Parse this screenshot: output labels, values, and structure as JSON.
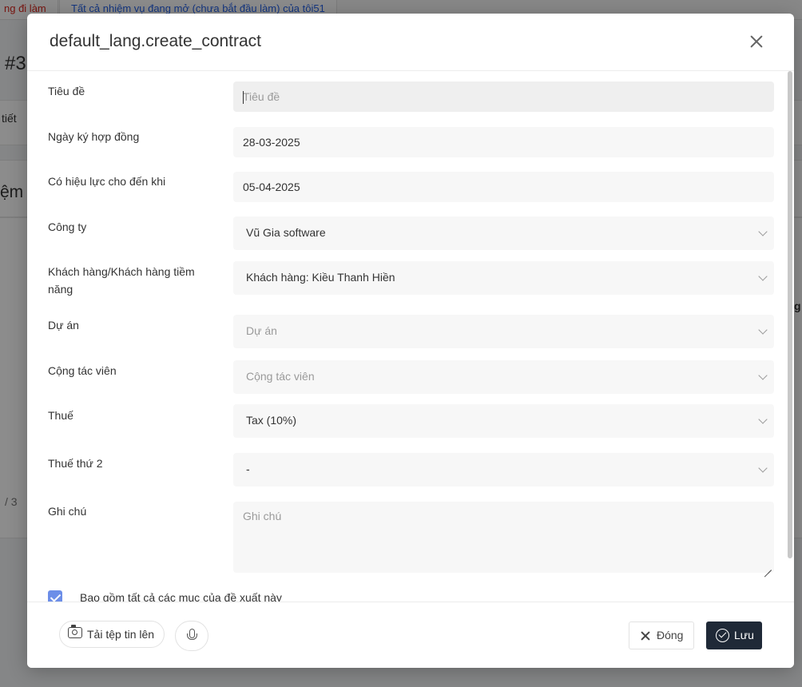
{
  "background": {
    "tabs": [
      "ng đi làm",
      "Tất cả nhiệm vụ đang mở (chưa bắt đầu làm) của tôi51"
    ],
    "fragments": {
      "hash_number": "#3",
      "tiet": "tiết",
      "nhiem": "ệm",
      "page": "/ 3",
      "edge_char": "g"
    }
  },
  "modal": {
    "title": "default_lang.create_contract",
    "fields": {
      "title": {
        "label": "Tiêu đề",
        "placeholder": "Tiêu đề"
      },
      "sign_date": {
        "label": "Ngày ký hợp đồng",
        "value": "28-03-2025"
      },
      "valid_until": {
        "label": "Có hiệu lực cho đến khi",
        "value": "05-04-2025"
      },
      "company": {
        "label": "Công ty",
        "value": "Vũ Gia software"
      },
      "customer": {
        "label": "Khách hàng/Khách hàng tiềm năng",
        "value": "Khách hàng: Kiều Thanh Hiền"
      },
      "project": {
        "label": "Dự án",
        "placeholder": "Dự án"
      },
      "collaborator": {
        "label": "Cộng tác viên",
        "placeholder": "Cộng tác viên"
      },
      "tax": {
        "label": "Thuế",
        "value": "Tax (10%)"
      },
      "tax2": {
        "label": "Thuế thứ 2",
        "value": "-"
      },
      "note": {
        "label": "Ghi chú",
        "placeholder": "Ghi chú"
      }
    },
    "include_items": {
      "label": "Bao gồm tất cả các mục của đề xuất này",
      "checked": true
    },
    "footer": {
      "upload_label": "Tải tệp tin lên",
      "close_label": "Đóng",
      "save_label": "Lưu"
    }
  },
  "colors": {
    "primary_dark": "#1f2937",
    "checkbox": "#6c8ee8",
    "link": "#2563eb",
    "alert": "#d9261c"
  },
  "icons": [
    "close-icon",
    "chevron-down-icon",
    "camera-icon",
    "microphone-icon",
    "check-circle-icon"
  ]
}
